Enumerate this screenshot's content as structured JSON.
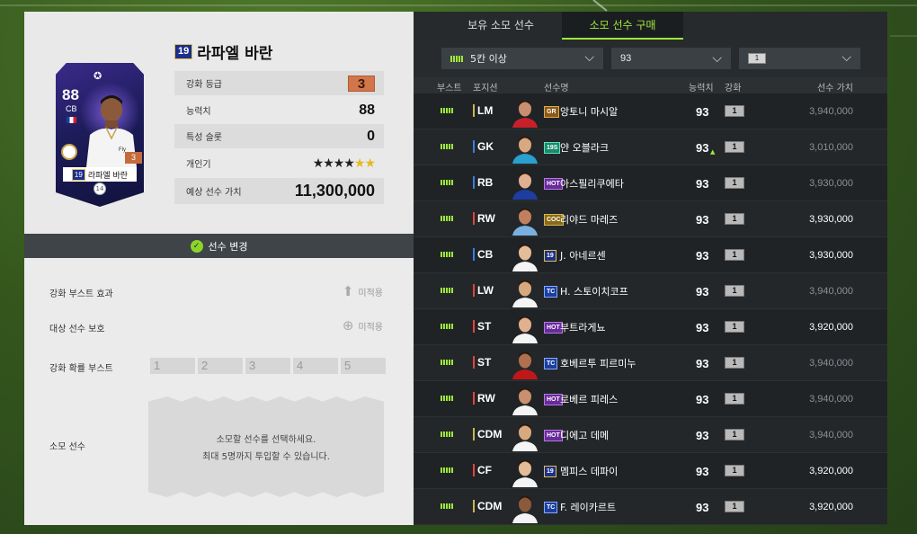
{
  "colors": {
    "accent": "#9ee83a",
    "panel_dark": "#1f2326",
    "panel_light": "#ebebeb",
    "grade_orange": "#d1764a"
  },
  "card": {
    "ovr": "88",
    "position": "CB",
    "season": "19",
    "name": "라파엘 바란",
    "level": "3",
    "grade": "14",
    "icon": "ucl-star-icon"
  },
  "player": {
    "season": "19",
    "name": "라파엘 바란"
  },
  "stats": {
    "grade_label": "강화 등급",
    "grade_value": "3",
    "ability_label": "능력치",
    "ability_value": "88",
    "trait_label": "특성 슬롯",
    "trait_value": "0",
    "popularity_label": "개인기",
    "popularity_black": "★★★★",
    "popularity_gold": "★★",
    "price_label": "예상 선수 가치",
    "price_value": "11,300,000"
  },
  "change_button": {
    "icon": "check-icon",
    "label": "선수 변경"
  },
  "options": {
    "boost_effect_label": "강화 부스트 효과",
    "boost_effect_status": "미적용",
    "protect_label": "대상 선수 보호",
    "protect_status": "미적용",
    "prob_boost_label": "강화 확률 부스트",
    "slots": [
      "1",
      "2",
      "3",
      "4",
      "5"
    ],
    "sacrifice_label": "소모 선수",
    "sacrifice_line1": "소모할 선수를 선택하세요.",
    "sacrifice_line2": "최대 5명까지 투입할 수 있습니다."
  },
  "tabs": [
    {
      "label": "보유 소모 선수"
    },
    {
      "label": "소모 선수 구매"
    }
  ],
  "filters": {
    "boost": "5칸 이상",
    "ovr": "93",
    "level": "1"
  },
  "table_headers": {
    "boost": "부스트",
    "position": "포지션",
    "name": "선수명",
    "ovr": "능력치",
    "enhance": "강화",
    "value": "선수 가치"
  },
  "rows": [
    {
      "pos": "LM",
      "season": "GR",
      "name": "앙토니 마시알",
      "ovr": "93",
      "enh": "1",
      "value": "3,940,000",
      "up": false
    },
    {
      "pos": "GK",
      "season": "19S",
      "name": "얀 오블라크",
      "ovr": "93",
      "enh": "1",
      "value": "3,010,000",
      "up": true,
      "up_mark": "▲"
    },
    {
      "pos": "RB",
      "season": "HOT",
      "name": "아스필리쿠에타",
      "ovr": "93",
      "enh": "1",
      "value": "3,930,000",
      "up": false
    },
    {
      "pos": "RW",
      "season": "COC",
      "name": "리야드 마레즈",
      "ovr": "93",
      "enh": "1",
      "value": "3,930,000",
      "up": false
    },
    {
      "pos": "CB",
      "season": "19",
      "name": "J. 아네르센",
      "ovr": "93",
      "enh": "1",
      "value": "3,930,000",
      "up": false
    },
    {
      "pos": "LW",
      "season": "TC",
      "name": "H. 스토이치코프",
      "ovr": "93",
      "enh": "1",
      "value": "3,940,000",
      "up": false
    },
    {
      "pos": "ST",
      "season": "HOT",
      "name": "부트라게뇨",
      "ovr": "93",
      "enh": "1",
      "value": "3,920,000",
      "up": false
    },
    {
      "pos": "ST",
      "season": "TC",
      "name": "호베르투 피르미누",
      "ovr": "93",
      "enh": "1",
      "value": "3,940,000",
      "up": false
    },
    {
      "pos": "RW",
      "season": "HOT",
      "name": "로베르 피레스",
      "ovr": "93",
      "enh": "1",
      "value": "3,940,000",
      "up": false
    },
    {
      "pos": "CDM",
      "season": "HOT",
      "name": "디에고 데메",
      "ovr": "93",
      "enh": "1",
      "value": "3,940,000",
      "up": false
    },
    {
      "pos": "CF",
      "season": "19",
      "name": "멤피스 데파이",
      "ovr": "93",
      "enh": "1",
      "value": "3,920,000",
      "up": false
    },
    {
      "pos": "CDM",
      "season": "TC",
      "name": "F. 레이카르트",
      "ovr": "93",
      "enh": "1",
      "value": "3,920,000",
      "up": false
    }
  ]
}
